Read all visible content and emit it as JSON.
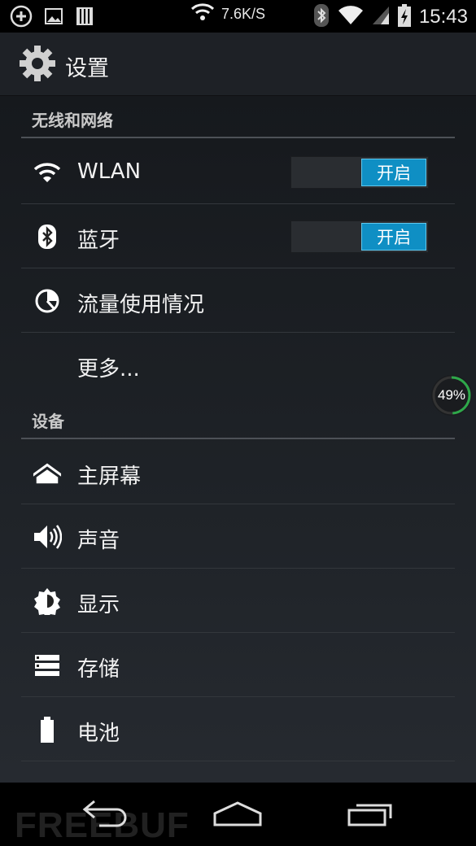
{
  "status_bar": {
    "left_icons": [
      "add-circle-icon",
      "image-icon",
      "sim-bars-icon"
    ],
    "net_speed": "7.6K/S",
    "right_icons": [
      "bluetooth-icon",
      "wifi-icon",
      "signal-icon",
      "battery-charging-icon"
    ],
    "time": "15:43"
  },
  "action_bar": {
    "icon": "gear-icon",
    "title": "设置"
  },
  "sections": [
    {
      "header": "无线和网络",
      "items": [
        {
          "icon": "wifi-icon",
          "label": "WLAN",
          "toggle": "开启"
        },
        {
          "icon": "bluetooth-icon",
          "label": "蓝牙",
          "toggle": "开启"
        },
        {
          "icon": "data-usage-icon",
          "label": "流量使用情况"
        },
        {
          "icon": "",
          "label": "更多..."
        }
      ]
    },
    {
      "header": "设备",
      "items": [
        {
          "icon": "home-icon",
          "label": "主屏幕"
        },
        {
          "icon": "speaker-icon",
          "label": "声音"
        },
        {
          "icon": "brightness-icon",
          "label": "显示"
        },
        {
          "icon": "storage-icon",
          "label": "存储"
        },
        {
          "icon": "battery-icon",
          "label": "电池"
        }
      ]
    }
  ],
  "floating_badge": {
    "text": "49%",
    "value": 0.49,
    "color": "#2ea84a"
  },
  "nav_bar": {
    "buttons": [
      "back-icon",
      "home-outline-icon",
      "recent-apps-icon"
    ],
    "watermark": "FREEBUF"
  },
  "colors": {
    "accent": "#0f8fc4",
    "background": "#1f2328",
    "divider": "#33373c"
  }
}
